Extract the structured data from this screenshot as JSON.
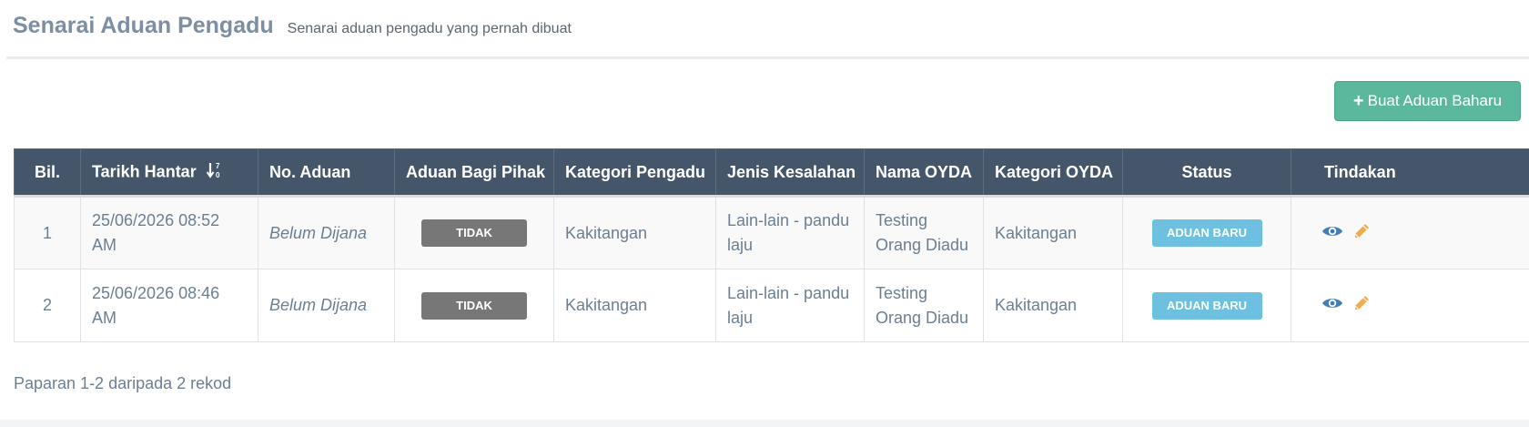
{
  "header": {
    "title": "Senarai Aduan Pengadu",
    "subtitle": "Senarai aduan pengadu yang pernah dibuat"
  },
  "toolbar": {
    "new_button_label": "Buat Aduan Baharu",
    "new_button_icon": "plus-icon",
    "accent_color": "#5cb89c"
  },
  "table": {
    "columns": {
      "bil": "Bil.",
      "tarikh": "Tarikh Hantar",
      "no_aduan": "No. Aduan",
      "bagi_pihak": "Aduan Bagi Pihak",
      "kategori_pengadu": "Kategori Pengadu",
      "jenis_kesalahan": "Jenis Kesalahan",
      "nama_oyda": "Nama OYDA",
      "kategori_oyda": "Kategori OYDA",
      "status": "Status",
      "tindakan": "Tindakan"
    },
    "sort_icon": "sort-numeric-desc-icon",
    "header_color": "#45566a",
    "rows": [
      {
        "bil": "1",
        "tarikh": "25/06/2026 08:52 AM",
        "no_aduan": "Belum Dijana",
        "bagi_pihak": "TIDAK",
        "kategori_pengadu": "Kakitangan",
        "jenis_kesalahan": "Lain-lain - pandu laju",
        "nama_oyda": "Testing Orang Diadu",
        "kategori_oyda": "Kakitangan",
        "status": "ADUAN BARU"
      },
      {
        "bil": "2",
        "tarikh": "25/06/2026 08:46 AM",
        "no_aduan": "Belum Dijana",
        "bagi_pihak": "TIDAK",
        "kategori_pengadu": "Kakitangan",
        "jenis_kesalahan": "Lain-lain - pandu laju",
        "nama_oyda": "Testing Orang Diadu",
        "kategori_oyda": "Kakitangan",
        "status": "ADUAN BARU"
      }
    ],
    "action_icons": [
      "eye-icon",
      "pencil-icon"
    ],
    "status_color": "#6ec0e0",
    "tidak_color": "#777777"
  },
  "footer": {
    "summary": "Paparan 1-2 daripada 2 rekod"
  }
}
